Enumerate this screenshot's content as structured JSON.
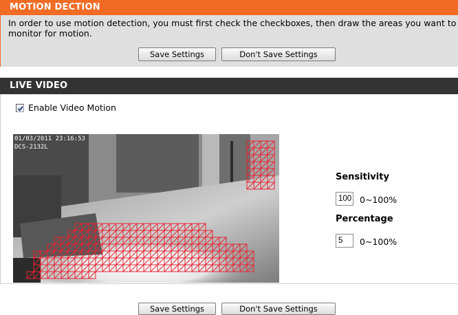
{
  "motion_section": {
    "title": "MOTION DECTION",
    "description": "In order to use motion detection, you must first check the checkboxes, then draw the areas you want to monitor for motion.",
    "save_label": "Save Settings",
    "dont_save_label": "Don't Save Settings"
  },
  "live_section": {
    "title": "LIVE VIDEO",
    "enable_label": "Enable Video Motion",
    "enable_checked": true,
    "overlay_date": "01/03/2011 23:16:53",
    "overlay_model": "DCS-2132L",
    "sensitivity_label": "Sensitivity",
    "sensitivity_value": "100",
    "sensitivity_range": "0~100%",
    "percentage_label": "Percentage",
    "percentage_value": "5",
    "percentage_range": "0~100%"
  },
  "footer": {
    "save_label": "Save Settings",
    "dont_save_label": "Don't Save Settings"
  },
  "colors": {
    "section_header_orange": "#f26b24",
    "section_header_dark": "#333333",
    "motion_grid": "#e8232f"
  },
  "icons": [
    "checkbox-checked-icon"
  ]
}
